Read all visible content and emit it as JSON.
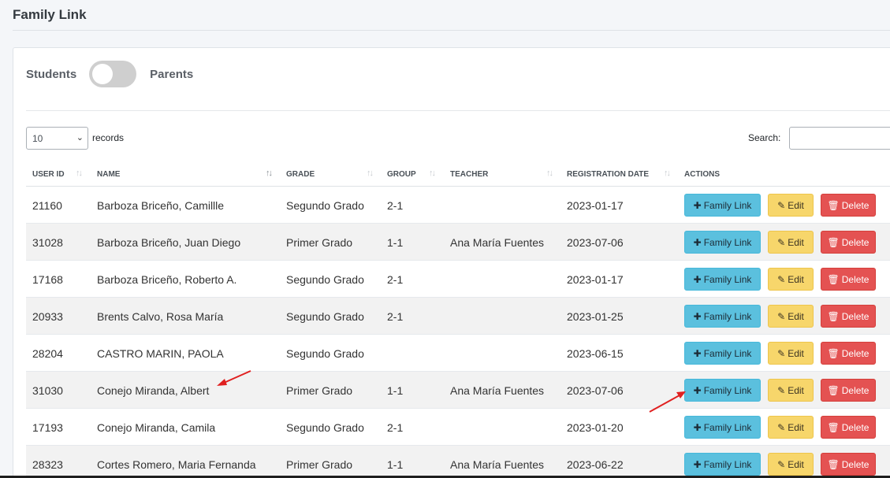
{
  "page": {
    "title": "Family Link"
  },
  "toggle": {
    "left_label": "Students",
    "right_label": "Parents"
  },
  "controls": {
    "length_value": "10",
    "records_label": "records",
    "search_label": "Search:",
    "search_value": ""
  },
  "columns": [
    "USER ID",
    "NAME",
    "GRADE",
    "GROUP",
    "TEACHER",
    "REGISTRATION DATE",
    "ACTIONS"
  ],
  "actions": {
    "family": "Family Link",
    "edit": "Edit",
    "delete": "Delete"
  },
  "rows": [
    {
      "id": "21160",
      "name": "Barboza Briceño, Camillle",
      "grade": "Segundo Grado",
      "group": "2-1",
      "teacher": "",
      "date": "2023-01-17"
    },
    {
      "id": "31028",
      "name": "Barboza Briceño, Juan Diego",
      "grade": "Primer Grado",
      "group": "1-1",
      "teacher": "Ana María Fuentes",
      "date": "2023-07-06"
    },
    {
      "id": "17168",
      "name": "Barboza Briceño, Roberto A.",
      "grade": "Segundo Grado",
      "group": "2-1",
      "teacher": "",
      "date": "2023-01-17"
    },
    {
      "id": "20933",
      "name": "Brents Calvo, Rosa María",
      "grade": "Segundo Grado",
      "group": "2-1",
      "teacher": "",
      "date": "2023-01-25"
    },
    {
      "id": "28204",
      "name": "CASTRO MARIN, PAOLA",
      "grade": "Segundo Grado",
      "group": "",
      "teacher": "",
      "date": "2023-06-15"
    },
    {
      "id": "31030",
      "name": "Conejo Miranda, Albert",
      "grade": "Primer Grado",
      "group": "1-1",
      "teacher": "Ana María Fuentes",
      "date": "2023-07-06"
    },
    {
      "id": "17193",
      "name": "Conejo Miranda, Camila",
      "grade": "Segundo Grado",
      "group": "2-1",
      "teacher": "",
      "date": "2023-01-20"
    },
    {
      "id": "28323",
      "name": "Cortes Romero, Maria Fernanda",
      "grade": "Primer Grado",
      "group": "1-1",
      "teacher": "Ana María Fuentes",
      "date": "2023-06-22"
    }
  ],
  "colors": {
    "family_button": "#5bc0de",
    "edit_button": "#f7d66b",
    "delete_button": "#e45252",
    "annotation_arrow": "#e02020"
  },
  "icons": {
    "family": "plus-icon",
    "edit": "edit-icon",
    "delete": "trash-icon",
    "sort": "sort-arrows-icon",
    "annotation": "red-arrow-icon"
  }
}
